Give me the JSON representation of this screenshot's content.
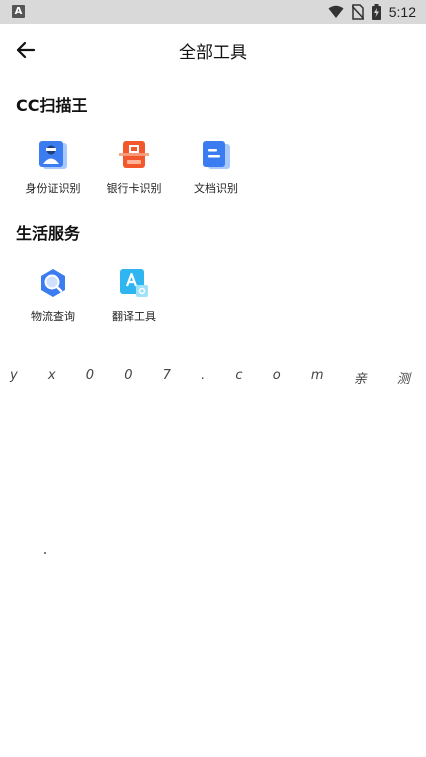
{
  "status_bar": {
    "app_badge": "A",
    "time": "5:12"
  },
  "header": {
    "title": "全部工具"
  },
  "sections": [
    {
      "title": "CC扫描王",
      "tools": [
        {
          "label": "身份证识别",
          "icon": "id-card-icon"
        },
        {
          "label": "银行卡识别",
          "icon": "bank-card-icon"
        },
        {
          "label": "文档识别",
          "icon": "document-icon"
        }
      ]
    },
    {
      "title": "生活服务",
      "tools": [
        {
          "label": "物流查询",
          "icon": "logistics-search-icon"
        },
        {
          "label": "翻译工具",
          "icon": "translate-icon"
        }
      ]
    }
  ],
  "watermark": [
    "y",
    "x",
    "0",
    "0",
    "7",
    ".",
    "c",
    "o",
    "m",
    "亲",
    "测"
  ],
  "colors": {
    "status_bar_bg": "#d9d9d9",
    "blue_accent": "#3b7cf0",
    "orange_accent": "#f2582c",
    "cyan_accent": "#2fb6f0"
  }
}
